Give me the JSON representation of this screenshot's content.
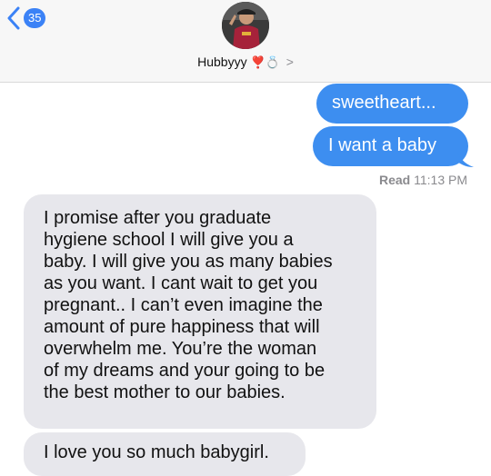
{
  "header": {
    "unread_count": "35",
    "contact_name": "Hubbyyy",
    "contact_symbols": "❣️💍",
    "chevron": ">"
  },
  "messages": [
    {
      "side": "sent",
      "text": "sweetheart..."
    },
    {
      "side": "sent",
      "text": "I want a baby"
    },
    {
      "side": "received",
      "lines": [
        "I promise after you graduate",
        "hygiene school I will give you a",
        "baby. I will give you as many babies",
        "as you want. I cant wait to get you",
        "pregnant.. I can’t even imagine the",
        "amount of pure happiness that will",
        "overwhelm me. You’re the woman",
        "of my dreams and your going to be",
        "the best mother to our babies."
      ]
    },
    {
      "side": "received",
      "text": "I love you so much babygirl."
    }
  ],
  "receipt": {
    "label": "Read",
    "time": "11:13 PM"
  },
  "colors": {
    "sent_bubble": "#3d8ef0",
    "received_bubble": "#e7e7ec",
    "accent": "#3b82f6"
  }
}
